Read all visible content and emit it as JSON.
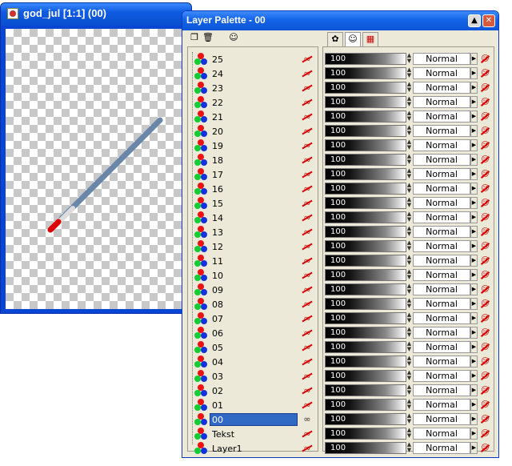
{
  "image_window": {
    "title": "god_jul [1:1] (00)",
    "icon": "paint-shop-document-icon"
  },
  "palette": {
    "title": "Layer Palette - 00",
    "toolbar_icons": [
      "new-layer-icon",
      "delete-layer-icon",
      "mask-icon"
    ],
    "tab_icons": [
      "visibility-tab-icon",
      "mask-tab-icon",
      "group-tab-icon"
    ],
    "title_buttons": {
      "minimize": "▲",
      "close": "✕"
    },
    "layers": [
      {
        "name": "25",
        "opacity": "100",
        "blend": "Normal",
        "visible": false
      },
      {
        "name": "24",
        "opacity": "100",
        "blend": "Normal",
        "visible": false
      },
      {
        "name": "23",
        "opacity": "100",
        "blend": "Normal",
        "visible": false
      },
      {
        "name": "22",
        "opacity": "100",
        "blend": "Normal",
        "visible": false
      },
      {
        "name": "21",
        "opacity": "100",
        "blend": "Normal",
        "visible": false
      },
      {
        "name": "20",
        "opacity": "100",
        "blend": "Normal",
        "visible": false
      },
      {
        "name": "19",
        "opacity": "100",
        "blend": "Normal",
        "visible": false
      },
      {
        "name": "18",
        "opacity": "100",
        "blend": "Normal",
        "visible": false
      },
      {
        "name": "17",
        "opacity": "100",
        "blend": "Normal",
        "visible": false
      },
      {
        "name": "16",
        "opacity": "100",
        "blend": "Normal",
        "visible": false
      },
      {
        "name": "15",
        "opacity": "100",
        "blend": "Normal",
        "visible": false
      },
      {
        "name": "14",
        "opacity": "100",
        "blend": "Normal",
        "visible": false
      },
      {
        "name": "13",
        "opacity": "100",
        "blend": "Normal",
        "visible": false
      },
      {
        "name": "12",
        "opacity": "100",
        "blend": "Normal",
        "visible": false
      },
      {
        "name": "11",
        "opacity": "100",
        "blend": "Normal",
        "visible": false
      },
      {
        "name": "10",
        "opacity": "100",
        "blend": "Normal",
        "visible": false
      },
      {
        "name": "09",
        "opacity": "100",
        "blend": "Normal",
        "visible": false
      },
      {
        "name": "08",
        "opacity": "100",
        "blend": "Normal",
        "visible": false
      },
      {
        "name": "07",
        "opacity": "100",
        "blend": "Normal",
        "visible": false
      },
      {
        "name": "06",
        "opacity": "100",
        "blend": "Normal",
        "visible": false
      },
      {
        "name": "05",
        "opacity": "100",
        "blend": "Normal",
        "visible": false
      },
      {
        "name": "04",
        "opacity": "100",
        "blend": "Normal",
        "visible": false
      },
      {
        "name": "03",
        "opacity": "100",
        "blend": "Normal",
        "visible": false
      },
      {
        "name": "02",
        "opacity": "100",
        "blend": "Normal",
        "visible": false
      },
      {
        "name": "01",
        "opacity": "100",
        "blend": "Normal",
        "visible": false
      },
      {
        "name": "00",
        "opacity": "100",
        "blend": "Normal",
        "visible": true,
        "selected": true
      },
      {
        "name": "Tekst",
        "opacity": "100",
        "blend": "Normal",
        "visible": false
      },
      {
        "name": "Layer1",
        "opacity": "100",
        "blend": "Normal",
        "visible": false
      }
    ]
  }
}
